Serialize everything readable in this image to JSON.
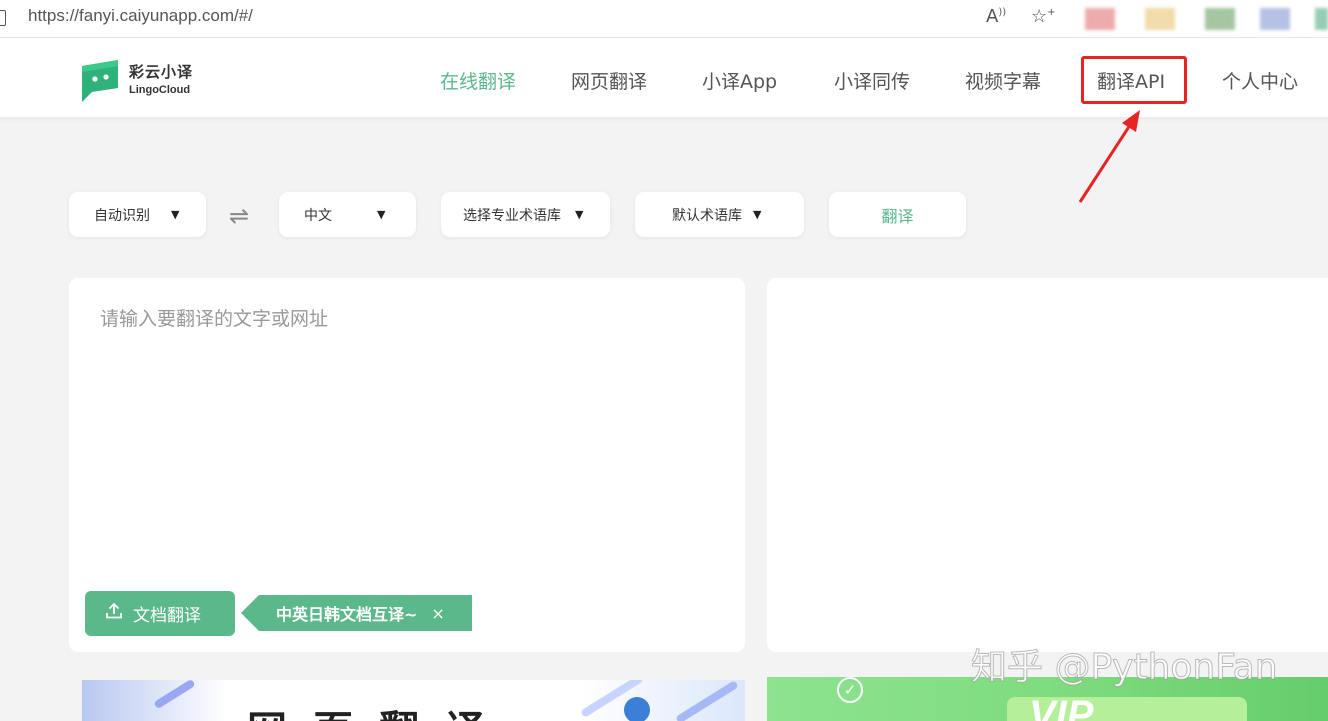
{
  "browser": {
    "url": "https://fanyi.caiyunapp.com/#/",
    "read_aloud_icon": "read-aloud-icon",
    "favorite_icon": "add-favorite-icon"
  },
  "logo": {
    "cn": "彩云小译",
    "en": "LingoCloud"
  },
  "nav": {
    "items": [
      {
        "label": "在线翻译"
      },
      {
        "label": "网页翻译"
      },
      {
        "label": "小译App"
      },
      {
        "label": "小译同传"
      },
      {
        "label": "视频字幕"
      },
      {
        "label": "翻译API"
      },
      {
        "label": "个人中心"
      }
    ]
  },
  "toolbar": {
    "source_lang": "自动识别",
    "target_lang": "中文",
    "glossary": "选择专业术语库",
    "default_glossary": "默认术语库",
    "translate_label": "翻译",
    "caret": "▼",
    "swap_icon": "⇌"
  },
  "input_panel": {
    "placeholder": "请输入要翻译的文字或网址"
  },
  "doc": {
    "button_label": "文档翻译",
    "tag_text": "中英日韩文档互译~",
    "close_label": "×"
  },
  "banners": {
    "left_text": "网页翻译",
    "right_vip": "VIP"
  },
  "watermark": "知乎 @PythonFan",
  "colors": {
    "accent": "#5bb88a",
    "highlight": "#e82323",
    "background": "#f3f3f3"
  }
}
